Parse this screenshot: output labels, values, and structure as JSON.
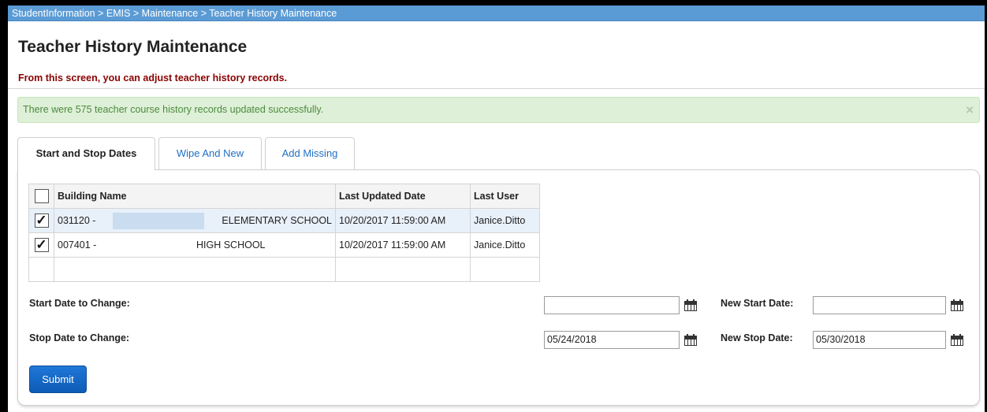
{
  "breadcrumb": "StudentInformation > EMIS > Maintenance > Teacher History Maintenance",
  "page_title": "Teacher History Maintenance",
  "subtitle": "From this screen, you can adjust teacher history records.",
  "alert": {
    "message": "There were 575 teacher course history records updated successfully.",
    "close_icon": "×"
  },
  "tabs": [
    {
      "label": "Start and Stop Dates",
      "active": true
    },
    {
      "label": "Wipe And New",
      "active": false
    },
    {
      "label": "Add Missing",
      "active": false
    }
  ],
  "table": {
    "headers": {
      "building_name": "Building Name",
      "last_updated": "Last Updated Date",
      "last_user": "Last User"
    },
    "rows": [
      {
        "checked": true,
        "code": "031120 -",
        "school": "ELEMENTARY SCHOOL",
        "last_updated": "10/20/2017 11:59:00 AM",
        "last_user": "Janice.Ditto"
      },
      {
        "checked": true,
        "code": "007401 -",
        "school": "HIGH SCHOOL",
        "last_updated": "10/20/2017 11:59:00 AM",
        "last_user": "Janice.Ditto"
      }
    ],
    "check_glyph": "✓"
  },
  "form": {
    "start_date_label": "Start Date to Change:",
    "stop_date_label": "Stop Date to Change:",
    "new_start_label": "New Start Date:",
    "new_stop_label": "New Stop Date:",
    "start_date_value": "",
    "stop_date_value": "05/24/2018",
    "new_start_value": "",
    "new_stop_value": "05/30/2018"
  },
  "submit_label": "Submit",
  "colors": {
    "breadcrumb_bg": "#5b9bd5",
    "alert_bg": "#dff0d8",
    "subtitle": "#8b0000",
    "link": "#1f6fc5",
    "button": "#1666c5"
  }
}
